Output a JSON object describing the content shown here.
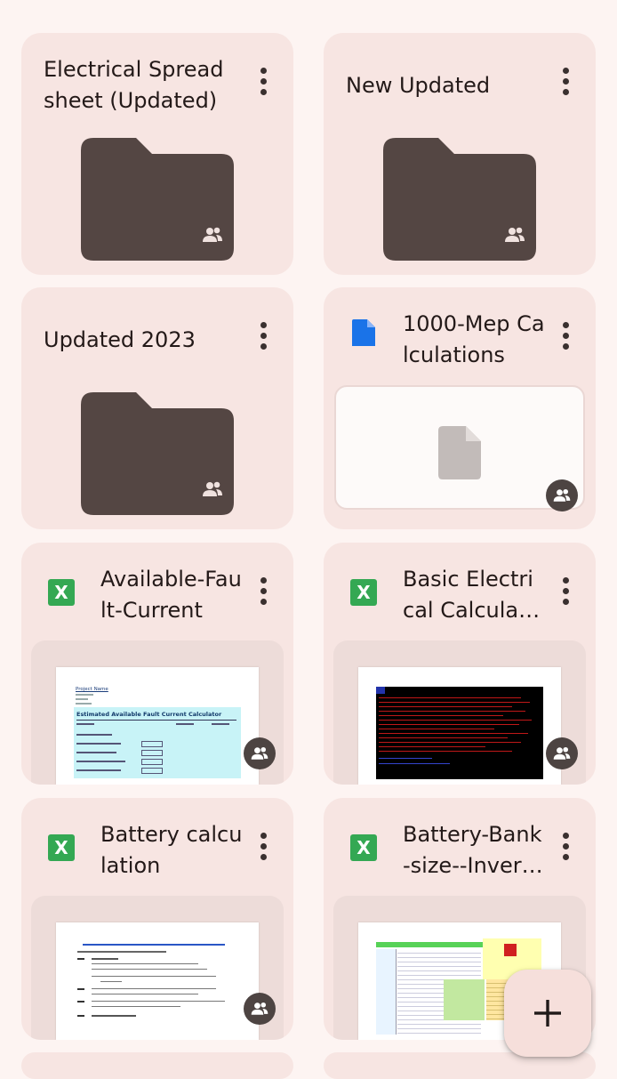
{
  "files": [
    {
      "title": "Electrical Spreadsheet (Updated)",
      "type": "folder",
      "shared": true
    },
    {
      "title": "New Updated",
      "type": "folder",
      "shared": true
    },
    {
      "title": "Updated 2023",
      "type": "folder",
      "shared": true
    },
    {
      "title": "1000-Mep Calculations",
      "type": "document",
      "shared": true
    },
    {
      "title": "Available-Fault-Current",
      "type": "spreadsheet",
      "shared": true,
      "preview": {
        "project_label": "Project Name",
        "heading": "Estimated Available Fault Current Calculator"
      }
    },
    {
      "title": "Basic Electrical Calculation",
      "type": "spreadsheet",
      "shared": true
    },
    {
      "title": "Battery calculation",
      "type": "spreadsheet",
      "shared": true
    },
    {
      "title": "Battery-Bank-size--Inverter",
      "type": "spreadsheet",
      "shared": true
    }
  ],
  "file_type_icons": {
    "spreadsheet_letter": "X"
  },
  "colors": {
    "background": "#fdf4f2",
    "card": "#f7e5e2",
    "folder": "#544643",
    "sheets_green": "#34a853",
    "docs_blue": "#1a73e8"
  },
  "fab": {
    "icon": "plus-icon"
  }
}
